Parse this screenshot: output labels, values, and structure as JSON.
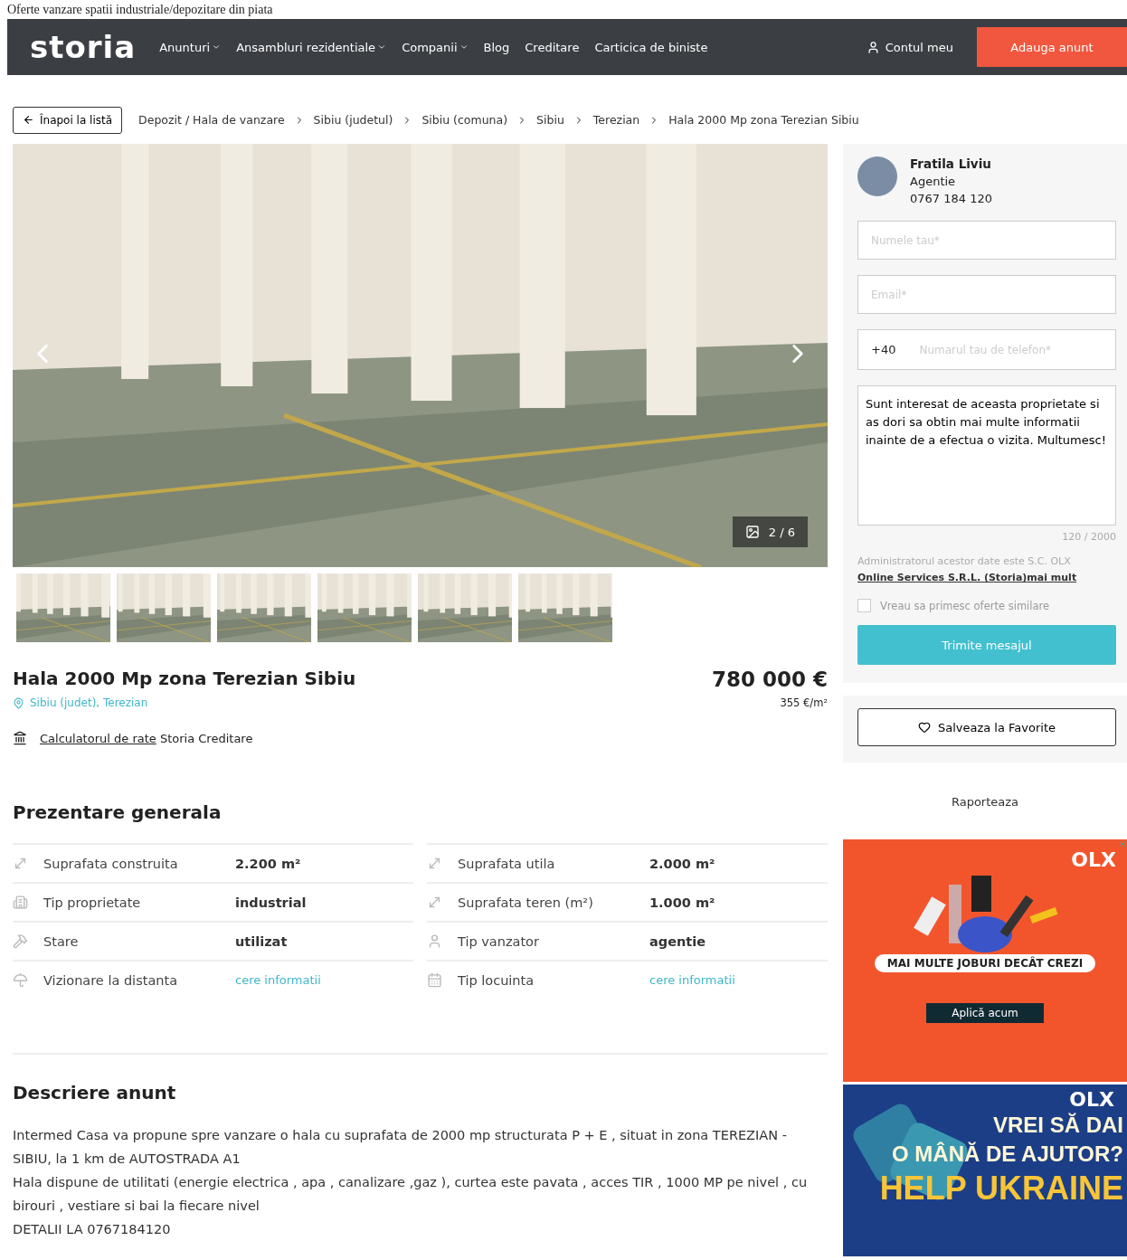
{
  "page_heading": "Oferte vanzare spatii industriale/depozitare din piata",
  "nav": {
    "logo": "storia",
    "menu": [
      {
        "label": "Anunturi",
        "dropdown": true
      },
      {
        "label": "Ansambluri rezidentiale",
        "dropdown": true
      },
      {
        "label": "Companii",
        "dropdown": true
      },
      {
        "label": "Blog",
        "dropdown": false
      },
      {
        "label": "Creditare",
        "dropdown": false
      },
      {
        "label": "Carticica de biniste",
        "dropdown": false
      }
    ],
    "account": "Contul meu",
    "cta": "Adauga anunt"
  },
  "back_button": "Înapoi la listă",
  "breadcrumbs": [
    "Depozit / Hala de vanzare",
    "Sibiu (judetul)",
    "Sibiu (comuna)",
    "Sibiu",
    "Terezian",
    "Hala 2000 Mp zona Terezian Sibiu"
  ],
  "gallery": {
    "counter": "2 / 6"
  },
  "listing": {
    "title": "Hala 2000 Mp zona Terezian Sibiu",
    "location": "Sibiu (judet), Terezian",
    "price": "780 000 €",
    "price_per_m2": "355 €/m²",
    "credit_link": "Calculatorul de rate",
    "credit_text": "Storia Creditare"
  },
  "overview": {
    "title": "Prezentare generala",
    "rows": [
      {
        "kind": "area",
        "label": "Suprafata construita",
        "value": "2.200 m²",
        "link": false
      },
      {
        "kind": "area",
        "label": "Suprafata utila",
        "value": "2.000 m²",
        "link": false
      },
      {
        "kind": "building",
        "label": "Tip proprietate",
        "value": "industrial",
        "link": false
      },
      {
        "kind": "area",
        "label": "Suprafata teren (m²)",
        "value": "1.000 m²",
        "link": false
      },
      {
        "kind": "hammer",
        "label": "Stare",
        "value": "utilizat",
        "link": false
      },
      {
        "kind": "person",
        "label": "Tip vanzator",
        "value": "agentie",
        "link": false
      },
      {
        "kind": "umbrella",
        "label": "Vizionare la distanta",
        "value": "cere informatii",
        "link": true
      },
      {
        "kind": "calendar",
        "label": "Tip locuinta",
        "value": "cere informatii",
        "link": true
      }
    ]
  },
  "description": {
    "title": "Descriere anunt",
    "paragraphs": [
      "Intermed Casa va propune spre vanzare o hala cu suprafata de 2000 mp structurata P + E , situat in zona TEREZIAN - SIBIU, la 1 km de AUTOSTRADA A1",
      "Hala dispune de utilitati (energie electrica , apa , canalizare ,gaz ), curtea este pavata , acces TIR , 1000 MP pe nivel , cu birouri , vestiare si bai la fiecare nivel",
      "DETALII LA 0767184120"
    ]
  },
  "contact": {
    "name": "Fratila Liviu",
    "role": "Agentie",
    "phone": "0767 184 120",
    "name_placeholder": "Numele tau*",
    "email_placeholder": "Email*",
    "phone_prefix": "+40",
    "phone_placeholder": "Numarul tau de telefon*",
    "message": "Sunt interesat de aceasta proprietate si as dori sa obtin mai multe informatii inainte de a efectua o vizita. Multumesc!",
    "counter": "120 / 2000",
    "admin_text": "Administratorul acestor date este S.C. OLX",
    "admin_link": "Online Services S.R.L. (Storia)",
    "more_link": "mai mult",
    "offers_checkbox": {
      "label": "Vreau sa primesc oferte similare",
      "checked": false
    },
    "send": "Trimite mesajul",
    "favorite": "Salveaza la Favorite",
    "report": "Raporteaza"
  },
  "ads": [
    {
      "kind": "jobs",
      "brand": "OLX",
      "headline": "MAI MULTE JOBURI DECÂT CREZI",
      "button": "Aplică acum"
    },
    {
      "kind": "ukraine",
      "brand": "OLX",
      "lines": [
        "VREI SĂ DAI",
        "O MÂNĂ DE AJUTOR?"
      ],
      "highlight": "HELP UKRAINE"
    }
  ]
}
